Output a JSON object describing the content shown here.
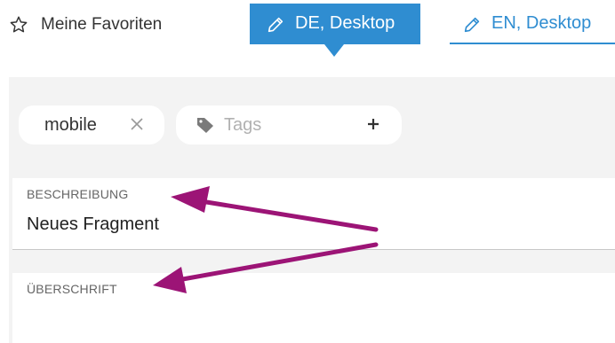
{
  "favorites": {
    "label": "Meine Favoriten"
  },
  "tabs": [
    {
      "label": "DE, Desktop",
      "active": true
    },
    {
      "label": "EN, Desktop",
      "active": false
    }
  ],
  "tags": {
    "chips": [
      {
        "label": "mobile"
      }
    ],
    "input_placeholder": "Tags"
  },
  "fields": {
    "description": {
      "label": "BESCHREIBUNG",
      "value": "Neues Fragment"
    },
    "heading": {
      "label": "ÜBERSCHRIFT",
      "value": ""
    }
  },
  "colors": {
    "accent": "#2f8dd1",
    "annotation_arrow": "#9c1476"
  }
}
